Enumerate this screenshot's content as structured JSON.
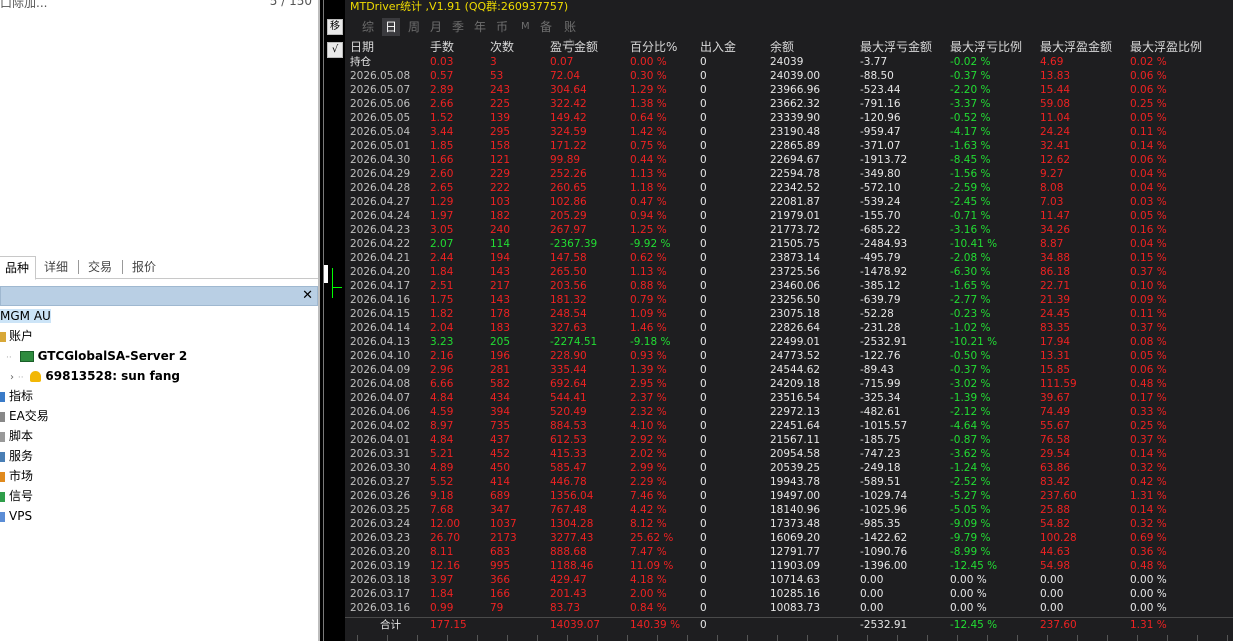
{
  "navigator": {
    "top_left_text": "口际加...",
    "top_right_text": "5 / 150",
    "tabs": [
      "品种",
      "详细",
      "交易",
      "报价"
    ],
    "active_tab": "品种",
    "close_glyph": "✕",
    "tree": {
      "symbol": "MGM AU",
      "accounts_label": "账户",
      "server": "GTCGlobalSA-Server 2",
      "account": "69813528: sun fang",
      "items": [
        "指标",
        "EA交易",
        "脚本",
        "服务",
        "市场",
        "信号",
        "VPS"
      ]
    }
  },
  "chart": {
    "side_buttons": [
      "移",
      "√"
    ],
    "panel": {
      "title": "MTDriver统计 ,V1.91 (QQ群:260937757)",
      "menu": [
        "综",
        "日",
        "周",
        "月",
        "季",
        "年",
        "币",
        "M",
        "备",
        "账户"
      ],
      "active_menu": "日",
      "columns": [
        "日期",
        "手数",
        "次数",
        "盈亏金额",
        "百分比%",
        "出入金",
        "余额",
        "最大浮亏金额",
        "最大浮亏比例",
        "最大浮盈金额",
        "最大浮盈比例"
      ],
      "rows": [
        [
          "持仓",
          "0.03",
          "3",
          "0.07",
          "0.00 %",
          "0",
          "24039",
          "-3.77",
          "-0.02 %",
          "4.69",
          "0.02 %"
        ],
        [
          "2026.05.08",
          "0.57",
          "53",
          "72.04",
          "0.30 %",
          "0",
          "24039.00",
          "-88.50",
          "-0.37 %",
          "13.83",
          "0.06 %"
        ],
        [
          "2026.05.07",
          "2.89",
          "243",
          "304.64",
          "1.29 %",
          "0",
          "23966.96",
          "-523.44",
          "-2.20 %",
          "15.44",
          "0.06 %"
        ],
        [
          "2026.05.06",
          "2.66",
          "225",
          "322.42",
          "1.38 %",
          "0",
          "23662.32",
          "-791.16",
          "-3.37 %",
          "59.08",
          "0.25 %"
        ],
        [
          "2026.05.05",
          "1.52",
          "139",
          "149.42",
          "0.64 %",
          "0",
          "23339.90",
          "-120.96",
          "-0.52 %",
          "11.04",
          "0.05 %"
        ],
        [
          "2026.05.04",
          "3.44",
          "295",
          "324.59",
          "1.42 %",
          "0",
          "23190.48",
          "-959.47",
          "-4.17 %",
          "24.24",
          "0.11 %"
        ],
        [
          "2026.05.01",
          "1.85",
          "158",
          "171.22",
          "0.75 %",
          "0",
          "22865.89",
          "-371.07",
          "-1.63 %",
          "32.41",
          "0.14 %"
        ],
        [
          "2026.04.30",
          "1.66",
          "121",
          "99.89",
          "0.44 %",
          "0",
          "22694.67",
          "-1913.72",
          "-8.45 %",
          "12.62",
          "0.06 %"
        ],
        [
          "2026.04.29",
          "2.60",
          "229",
          "252.26",
          "1.13 %",
          "0",
          "22594.78",
          "-349.80",
          "-1.56 %",
          "9.27",
          "0.04 %"
        ],
        [
          "2026.04.28",
          "2.65",
          "222",
          "260.65",
          "1.18 %",
          "0",
          "22342.52",
          "-572.10",
          "-2.59 %",
          "8.08",
          "0.04 %"
        ],
        [
          "2026.04.27",
          "1.29",
          "103",
          "102.86",
          "0.47 %",
          "0",
          "22081.87",
          "-539.24",
          "-2.45 %",
          "7.03",
          "0.03 %"
        ],
        [
          "2026.04.24",
          "1.97",
          "182",
          "205.29",
          "0.94 %",
          "0",
          "21979.01",
          "-155.70",
          "-0.71 %",
          "11.47",
          "0.05 %"
        ],
        [
          "2026.04.23",
          "3.05",
          "240",
          "267.97",
          "1.25 %",
          "0",
          "21773.72",
          "-685.22",
          "-3.16 %",
          "34.26",
          "0.16 %"
        ],
        [
          "2026.04.22",
          "2.07",
          "114",
          "-2367.39",
          "-9.92 %",
          "0",
          "21505.75",
          "-2484.93",
          "-10.41 %",
          "8.87",
          "0.04 %"
        ],
        [
          "2026.04.21",
          "2.44",
          "194",
          "147.58",
          "0.62 %",
          "0",
          "23873.14",
          "-495.79",
          "-2.08 %",
          "34.88",
          "0.15 %"
        ],
        [
          "2026.04.20",
          "1.84",
          "143",
          "265.50",
          "1.13 %",
          "0",
          "23725.56",
          "-1478.92",
          "-6.30 %",
          "86.18",
          "0.37 %"
        ],
        [
          "2026.04.17",
          "2.51",
          "217",
          "203.56",
          "0.88 %",
          "0",
          "23460.06",
          "-385.12",
          "-1.65 %",
          "22.71",
          "0.10 %"
        ],
        [
          "2026.04.16",
          "1.75",
          "143",
          "181.32",
          "0.79 %",
          "0",
          "23256.50",
          "-639.79",
          "-2.77 %",
          "21.39",
          "0.09 %"
        ],
        [
          "2026.04.15",
          "1.82",
          "178",
          "248.54",
          "1.09 %",
          "0",
          "23075.18",
          "-52.28",
          "-0.23 %",
          "24.45",
          "0.11 %"
        ],
        [
          "2026.04.14",
          "2.04",
          "183",
          "327.63",
          "1.46 %",
          "0",
          "22826.64",
          "-231.28",
          "-1.02 %",
          "83.35",
          "0.37 %"
        ],
        [
          "2026.04.13",
          "3.23",
          "205",
          "-2274.51",
          "-9.18 %",
          "0",
          "22499.01",
          "-2532.91",
          "-10.21 %",
          "17.94",
          "0.08 %"
        ],
        [
          "2026.04.10",
          "2.16",
          "196",
          "228.90",
          "0.93 %",
          "0",
          "24773.52",
          "-122.76",
          "-0.50 %",
          "13.31",
          "0.05 %"
        ],
        [
          "2026.04.09",
          "2.96",
          "281",
          "335.44",
          "1.39 %",
          "0",
          "24544.62",
          "-89.43",
          "-0.37 %",
          "15.85",
          "0.06 %"
        ],
        [
          "2026.04.08",
          "6.66",
          "582",
          "692.64",
          "2.95 %",
          "0",
          "24209.18",
          "-715.99",
          "-3.02 %",
          "111.59",
          "0.48 %"
        ],
        [
          "2026.04.07",
          "4.84",
          "434",
          "544.41",
          "2.37 %",
          "0",
          "23516.54",
          "-325.34",
          "-1.39 %",
          "39.67",
          "0.17 %"
        ],
        [
          "2026.04.06",
          "4.59",
          "394",
          "520.49",
          "2.32 %",
          "0",
          "22972.13",
          "-482.61",
          "-2.12 %",
          "74.49",
          "0.33 %"
        ],
        [
          "2026.04.02",
          "8.97",
          "735",
          "884.53",
          "4.10 %",
          "0",
          "22451.64",
          "-1015.57",
          "-4.64 %",
          "55.67",
          "0.25 %"
        ],
        [
          "2026.04.01",
          "4.84",
          "437",
          "612.53",
          "2.92 %",
          "0",
          "21567.11",
          "-185.75",
          "-0.87 %",
          "76.58",
          "0.37 %"
        ],
        [
          "2026.03.31",
          "5.21",
          "452",
          "415.33",
          "2.02 %",
          "0",
          "20954.58",
          "-747.23",
          "-3.62 %",
          "29.54",
          "0.14 %"
        ],
        [
          "2026.03.30",
          "4.89",
          "450",
          "585.47",
          "2.99 %",
          "0",
          "20539.25",
          "-249.18",
          "-1.24 %",
          "63.86",
          "0.32 %"
        ],
        [
          "2026.03.27",
          "5.52",
          "414",
          "446.78",
          "2.29 %",
          "0",
          "19943.78",
          "-589.51",
          "-2.52 %",
          "83.42",
          "0.42 %"
        ],
        [
          "2026.03.26",
          "9.18",
          "689",
          "1356.04",
          "7.46 %",
          "0",
          "19497.00",
          "-1029.74",
          "-5.27 %",
          "237.60",
          "1.31 %"
        ],
        [
          "2026.03.25",
          "7.68",
          "347",
          "767.48",
          "4.42 %",
          "0",
          "18140.96",
          "-1025.96",
          "-5.05 %",
          "25.88",
          "0.14 %"
        ],
        [
          "2026.03.24",
          "12.00",
          "1037",
          "1304.28",
          "8.12 %",
          "0",
          "17373.48",
          "-985.35",
          "-9.09 %",
          "54.82",
          "0.32 %"
        ],
        [
          "2026.03.23",
          "26.70",
          "2173",
          "3277.43",
          "25.62 %",
          "0",
          "16069.20",
          "-1422.62",
          "-9.79 %",
          "100.28",
          "0.69 %"
        ],
        [
          "2026.03.20",
          "8.11",
          "683",
          "888.68",
          "7.47 %",
          "0",
          "12791.77",
          "-1090.76",
          "-8.99 %",
          "44.63",
          "0.36 %"
        ],
        [
          "2026.03.19",
          "12.16",
          "995",
          "1188.46",
          "11.09 %",
          "0",
          "11903.09",
          "-1396.00",
          "-12.45 %",
          "54.98",
          "0.48 %"
        ],
        [
          "2026.03.18",
          "3.97",
          "366",
          "429.47",
          "4.18 %",
          "0",
          "10714.63",
          "0.00",
          "0.00 %",
          "0.00",
          "0.00 %"
        ],
        [
          "2026.03.17",
          "1.84",
          "166",
          "201.43",
          "2.00 %",
          "0",
          "10285.16",
          "0.00",
          "0.00 %",
          "0.00",
          "0.00 %"
        ],
        [
          "2026.03.16",
          "0.99",
          "79",
          "83.73",
          "0.84 %",
          "0",
          "10083.73",
          "0.00",
          "0.00 %",
          "0.00",
          "0.00 %"
        ]
      ],
      "total": {
        "label": "合计",
        "lots": "177.15",
        "count": "",
        "pnl": "14039.07",
        "pct": "140.39 %",
        "deposit": "0",
        "balance": "",
        "max_dd_amount": "-2532.91",
        "max_dd_pct": "-12.45 %",
        "max_profit_amount": "237.60",
        "max_profit_pct": "1.31 %"
      }
    }
  },
  "colors": {
    "profit": "#ee2222",
    "loss": "#22dd33",
    "title": "#f0dc00",
    "panel_bg": "#1e1e20"
  }
}
